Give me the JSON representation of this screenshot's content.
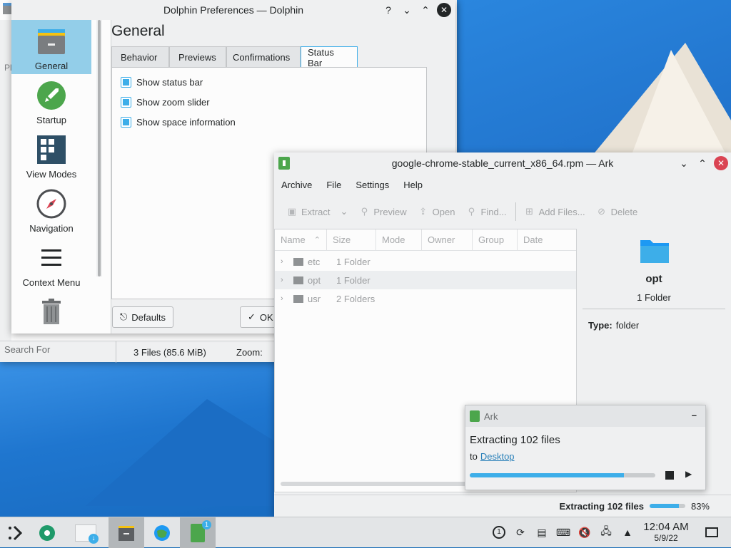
{
  "dolphin": {
    "status_files": "3 Files (85.6 MiB)",
    "status_zoom": "Zoom:",
    "search_for": "Search For"
  },
  "prefs": {
    "title": "Dolphin Preferences — Dolphin",
    "heading": "General",
    "nav": [
      {
        "label": "General",
        "icon": "folder-icon"
      },
      {
        "label": "Startup",
        "icon": "rocket-icon"
      },
      {
        "label": "View Modes",
        "icon": "view-grid-icon"
      },
      {
        "label": "Navigation",
        "icon": "compass-icon"
      },
      {
        "label": "Context Menu",
        "icon": "menu-lines-icon"
      },
      {
        "label": "Trash",
        "icon": "trash-icon"
      }
    ],
    "tabs": [
      "Behavior",
      "Previews",
      "Confirmations",
      "Status Bar"
    ],
    "active_tab": "Status Bar",
    "options": [
      "Show status bar",
      "Show zoom slider",
      "Show space information"
    ],
    "defaults_button": "Defaults",
    "ok_button": "OK"
  },
  "ark": {
    "title": "google-chrome-stable_current_x86_64.rpm — Ark",
    "menu": [
      "Archive",
      "File",
      "Settings",
      "Help"
    ],
    "toolbar": {
      "extract": "Extract",
      "preview": "Preview",
      "open": "Open",
      "find": "Find...",
      "add_files": "Add Files...",
      "delete": "Delete"
    },
    "columns": [
      "Name",
      "Size",
      "Mode",
      "Owner",
      "Group",
      "Date"
    ],
    "rows": [
      {
        "name": "etc",
        "size": "1 Folder"
      },
      {
        "name": "opt",
        "size": "1 Folder"
      },
      {
        "name": "usr",
        "size": "2 Folders"
      }
    ],
    "info": {
      "name": "opt",
      "count": "1 Folder",
      "type_label": "Type:",
      "type_value": "folder"
    },
    "status_text": "Extracting 102 files",
    "status_percent": "83%",
    "progress": 0.83
  },
  "notification": {
    "app": "Ark",
    "title": "Extracting 102 files",
    "to": "to",
    "destination": "Desktop",
    "progress": 0.83,
    "minimize": "–"
  },
  "taskbar": {
    "time": "12:04 AM",
    "date": "5/9/22",
    "badge": "1",
    "update_badge": "1"
  }
}
